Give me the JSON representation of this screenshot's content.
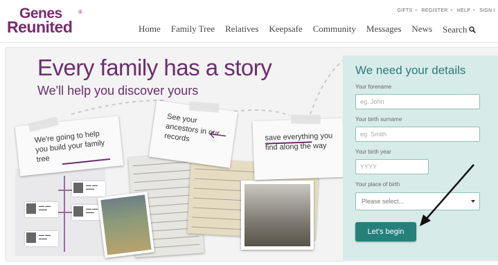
{
  "brand": {
    "line1": "Genes",
    "line2": "Reunited",
    "mark": "®"
  },
  "utility_nav": [
    "GIFTS",
    "REGISTER",
    "HELP",
    "SIGN I"
  ],
  "nav": [
    "Home",
    "Family Tree",
    "Relatives",
    "Keepsafe",
    "Community",
    "Messages",
    "News",
    "Search"
  ],
  "icons": {
    "search": "search-icon",
    "caret": "chevron-down-icon"
  },
  "hero": {
    "title": "Every family has a story",
    "subtitle": "We'll help you discover yours",
    "notes": [
      "We're going to help you build your family tree",
      "See your ancestors in our records",
      "save everything you find along the way"
    ]
  },
  "form": {
    "heading": "We need your details",
    "fields": [
      {
        "label": "Your forename",
        "placeholder": "eg. John"
      },
      {
        "label": "Your birth surname",
        "placeholder": "eg. Smith"
      },
      {
        "label": "Your birth year",
        "placeholder": "YYYY"
      },
      {
        "label": "Your place of birth",
        "placeholder": "Please select..."
      }
    ],
    "submit": "Let's begin"
  },
  "colors": {
    "brand": "#7a2a70",
    "hero_text": "#6b2d6e",
    "form_bg": "#d7ebe9",
    "form_heading": "#2d7a78",
    "button": "#25807c"
  }
}
